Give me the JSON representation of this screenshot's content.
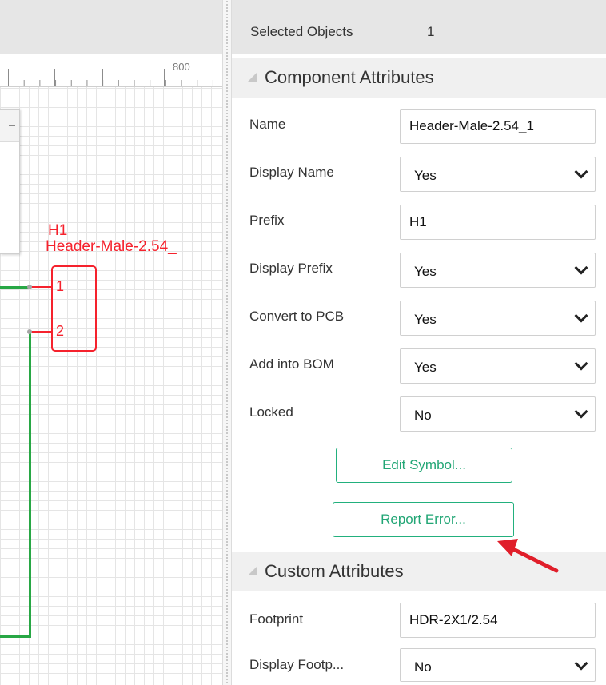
{
  "canvas": {
    "ruler_label": "800",
    "component": {
      "designator": "H1",
      "name": "Header-Male-2.54_",
      "pins": [
        "1",
        "2"
      ]
    },
    "colors": {
      "component": "#f5222d",
      "wire": "#28a745",
      "grid": "#e5e5e5"
    }
  },
  "properties": {
    "selected_label": "Selected Objects",
    "selected_count": "1",
    "component_section": "Component Attributes",
    "fields": {
      "name": {
        "label": "Name",
        "value": "Header-Male-2.54_1"
      },
      "display_name": {
        "label": "Display Name",
        "value": "Yes"
      },
      "prefix": {
        "label": "Prefix",
        "value": "H1"
      },
      "display_prefix": {
        "label": "Display Prefix",
        "value": "Yes"
      },
      "convert_pcb": {
        "label": "Convert to PCB",
        "value": "Yes"
      },
      "add_bom": {
        "label": "Add into BOM",
        "value": "Yes"
      },
      "locked": {
        "label": "Locked",
        "value": "No"
      }
    },
    "buttons": {
      "edit_symbol": "Edit Symbol...",
      "report_error": "Report Error..."
    },
    "custom_section": "Custom Attributes",
    "custom_fields": {
      "footprint": {
        "label": "Footprint",
        "value": "HDR-2X1/2.54"
      },
      "display_footprint": {
        "label": "Display Footp...",
        "value": "No"
      }
    },
    "accent_color": "#22b07d",
    "annotation_arrow_color": "#e01e2a"
  }
}
